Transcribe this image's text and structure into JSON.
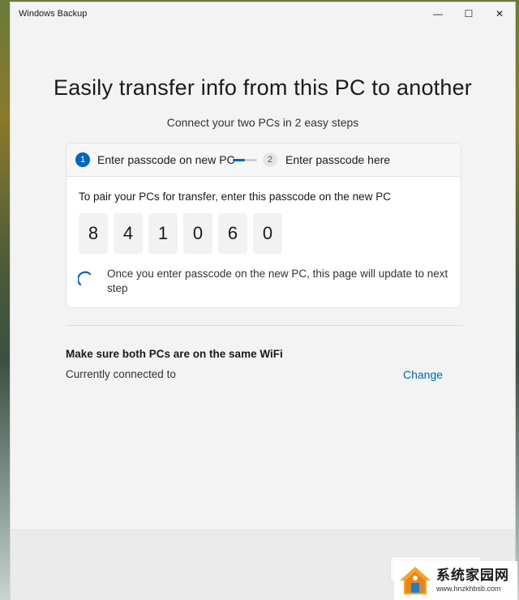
{
  "window": {
    "title": "Windows Backup",
    "minimize_glyph": "—",
    "maximize_glyph": "☐",
    "close_glyph": "✕"
  },
  "main": {
    "heading": "Easily transfer info from this PC to another",
    "subheading": "Connect your two PCs in 2 easy steps"
  },
  "stepper": {
    "steps": [
      {
        "number": "1",
        "label": "Enter passcode on new PC",
        "state": "active"
      },
      {
        "number": "2",
        "label": "Enter passcode here",
        "state": "pending"
      }
    ],
    "progress": 0.5
  },
  "passcode": {
    "instruction": "To pair your PCs for transfer, enter this passcode on the new PC",
    "digits": [
      "8",
      "4",
      "1",
      "0",
      "6",
      "0"
    ],
    "waiting_text": "Once you enter passcode on the new PC, this page will update to next step"
  },
  "wifi": {
    "title": "Make sure both PCs are on the same WiFi",
    "status": "Currently connected to",
    "change_label": "Change"
  },
  "watermark": {
    "title": "系统家园网",
    "url": "www.hnzkhbsb.com"
  },
  "colors": {
    "accent": "#0067c0",
    "window_bg": "#f3f3f3",
    "card_bg": "#ffffff"
  },
  "icons": {
    "spinner": "loading-spinner-icon",
    "minimize": "minimize-icon",
    "maximize": "maximize-icon",
    "close": "close-icon"
  }
}
